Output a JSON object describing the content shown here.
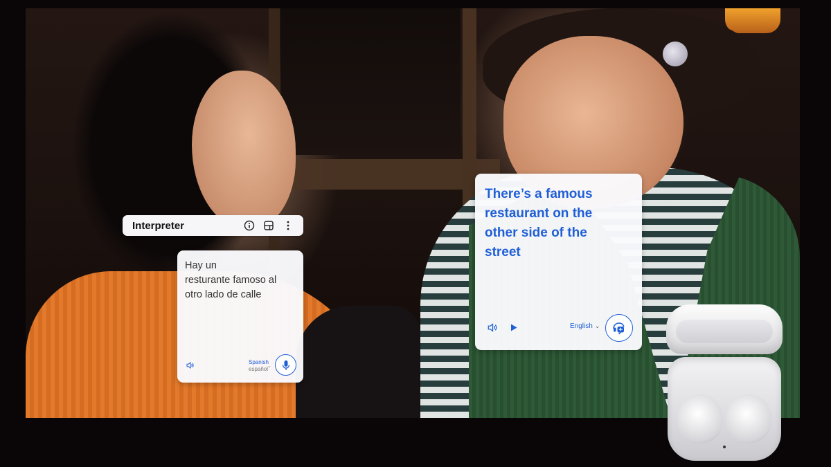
{
  "interpreter": {
    "title": "Interpreter",
    "icons": [
      "info-icon",
      "split-view-icon",
      "more-vert-icon"
    ]
  },
  "source_card": {
    "lines": [
      "Hay un",
      "resturante famoso al",
      "otro lado de calle"
    ],
    "language_label": "Spanish",
    "language_native": "español"
  },
  "target_card": {
    "lines": [
      "There’s a famous",
      "restaurant on the",
      "other side of the",
      "street"
    ],
    "language_label": "English"
  },
  "colors": {
    "accent": "#1f5fd6",
    "card_bg": "#fafafd"
  }
}
